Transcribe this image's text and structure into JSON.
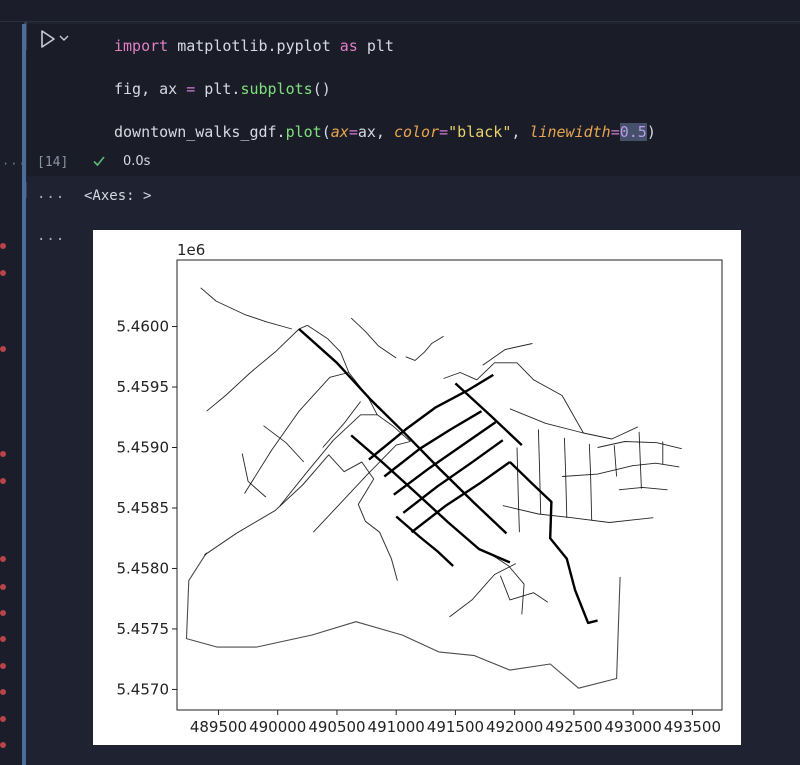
{
  "cell": {
    "execution_count": "[14]",
    "exec_time": "0.0s",
    "code": {
      "line1": {
        "kw1": "import",
        "mod": " matplotlib.pyplot ",
        "kw2": "as",
        "alias": " plt"
      },
      "line2": {
        "vars": "fig, ax ",
        "eq": "=",
        "sp": " plt.",
        "fn": "subplots",
        "paren": "()"
      },
      "line3": {
        "obj": "downtown_walks_gdf.",
        "fn": "plot",
        "p_open": "(",
        "arg1": "ax",
        "eq1": "=",
        "v1": "ax, ",
        "arg2": "color",
        "eq2": "=",
        "v2": "\"black\"",
        "comma": ", ",
        "arg3": "linewidth",
        "eq3": "=",
        "v3": "0.5",
        "p_close": ")"
      }
    }
  },
  "output": {
    "ellipsis_1": "···",
    "ellipsis_2": "···",
    "text": "<Axes: >"
  },
  "gutter": {
    "dotted": "·····"
  },
  "icons": {
    "run": "play-icon",
    "run_options": "chevron-down-icon",
    "success": "check-icon"
  },
  "colors": {
    "cell_bar": "#4b6d9a",
    "success": "#5fb877",
    "error_dot": "#b8434b"
  },
  "chart_data": {
    "type": "line",
    "title": "",
    "offset_label": "1e6",
    "xlabel": "",
    "ylabel": "",
    "xlim": [
      489150,
      493750
    ],
    "ylim": [
      5456830,
      5460550
    ],
    "x_ticks": [
      489500,
      490000,
      490500,
      491000,
      491500,
      492000,
      492500,
      493000,
      493500
    ],
    "x_tick_labels": [
      "489500",
      "490000",
      "490500",
      "491000",
      "491500",
      "492000",
      "492500",
      "493000",
      "493500"
    ],
    "y_ticks": [
      5457000,
      5457500,
      5458000,
      5458500,
      5459000,
      5459500,
      5460000
    ],
    "y_tick_labels": [
      "5.4570",
      "5.4575",
      "5.4580",
      "5.4585",
      "5.4590",
      "5.4595",
      "5.4600"
    ],
    "color": "#000000",
    "linewidth": 0.5,
    "series": [
      {
        "type": "boundary",
        "points": [
          [
            489400,
            5458130
          ],
          [
            489250,
            5457900
          ],
          [
            489230,
            5457420
          ],
          [
            489490,
            5457350
          ],
          [
            489820,
            5457350
          ],
          [
            490290,
            5457450
          ],
          [
            490660,
            5457560
          ],
          [
            491050,
            5457450
          ],
          [
            491360,
            5457310
          ],
          [
            491660,
            5457280
          ],
          [
            491960,
            5457160
          ],
          [
            492300,
            5457210
          ],
          [
            492540,
            5457010
          ],
          [
            492860,
            5457090
          ],
          [
            492890,
            5457930
          ]
        ]
      },
      {
        "type": "shore",
        "points": [
          [
            489380,
            5458110
          ],
          [
            489650,
            5458290
          ],
          [
            489980,
            5458480
          ],
          [
            490210,
            5458690
          ],
          [
            490430,
            5458940
          ],
          [
            490560,
            5458800
          ],
          [
            490710,
            5458880
          ],
          [
            490810,
            5458740
          ],
          [
            490680,
            5458530
          ],
          [
            490740,
            5458390
          ],
          [
            490860,
            5458300
          ],
          [
            490960,
            5458080
          ],
          [
            491010,
            5457900
          ]
        ]
      },
      {
        "type": "grid",
        "points": [
          [
            489400,
            5459300
          ],
          [
            489560,
            5459430
          ],
          [
            489770,
            5459620
          ],
          [
            489980,
            5459790
          ],
          [
            490180,
            5459980
          ],
          [
            490250,
            5460010
          ]
        ]
      },
      {
        "type": "grid",
        "points": [
          [
            489350,
            5460320
          ],
          [
            489480,
            5460210
          ],
          [
            489720,
            5460100
          ],
          [
            489900,
            5460040
          ],
          [
            490120,
            5459980
          ]
        ]
      },
      {
        "type": "grid",
        "points": [
          [
            490250,
            5460010
          ],
          [
            490420,
            5459900
          ],
          [
            490530,
            5459790
          ],
          [
            490600,
            5459620
          ],
          [
            490760,
            5459420
          ],
          [
            490840,
            5459270
          ],
          [
            490970,
            5459180
          ],
          [
            491120,
            5459050
          ]
        ]
      },
      {
        "type": "grid",
        "points": [
          [
            489720,
            5458620
          ],
          [
            489950,
            5458980
          ],
          [
            490180,
            5459300
          ],
          [
            490440,
            5459580
          ],
          [
            490600,
            5459620
          ]
        ]
      },
      {
        "type": "grid",
        "points": [
          [
            490020,
            5458520
          ],
          [
            490250,
            5458800
          ],
          [
            490470,
            5459060
          ],
          [
            490700,
            5459270
          ],
          [
            490840,
            5459270
          ]
        ]
      },
      {
        "type": "grid",
        "points": [
          [
            490300,
            5458300
          ],
          [
            490540,
            5458550
          ],
          [
            490750,
            5458770
          ],
          [
            491000,
            5459020
          ],
          [
            491120,
            5459050
          ]
        ]
      },
      {
        "type": "major",
        "points": [
          [
            490180,
            5459980
          ],
          [
            490500,
            5459700
          ],
          [
            490780,
            5459400
          ],
          [
            491080,
            5459110
          ],
          [
            491360,
            5458830
          ],
          [
            491660,
            5458540
          ],
          [
            491930,
            5458290
          ]
        ]
      },
      {
        "type": "major",
        "points": [
          [
            490620,
            5459100
          ],
          [
            490880,
            5458880
          ],
          [
            491150,
            5458640
          ],
          [
            491440,
            5458380
          ],
          [
            491700,
            5458160
          ],
          [
            491960,
            5458050
          ]
        ]
      },
      {
        "type": "major",
        "points": [
          [
            490770,
            5458900
          ],
          [
            491080,
            5459150
          ],
          [
            491330,
            5459330
          ],
          [
            491600,
            5459470
          ],
          [
            491820,
            5459600
          ]
        ]
      },
      {
        "type": "major",
        "points": [
          [
            490900,
            5458760
          ],
          [
            491200,
            5458990
          ],
          [
            491460,
            5459150
          ],
          [
            491720,
            5459300
          ]
        ]
      },
      {
        "type": "major",
        "points": [
          [
            490980,
            5458610
          ],
          [
            491280,
            5458830
          ],
          [
            491560,
            5459020
          ],
          [
            491840,
            5459210
          ]
        ]
      },
      {
        "type": "major",
        "points": [
          [
            491060,
            5458460
          ],
          [
            491350,
            5458680
          ],
          [
            491630,
            5458870
          ],
          [
            491900,
            5459060
          ]
        ]
      },
      {
        "type": "major",
        "points": [
          [
            491130,
            5458300
          ],
          [
            491420,
            5458520
          ],
          [
            491700,
            5458700
          ],
          [
            491960,
            5458880
          ]
        ]
      },
      {
        "type": "major",
        "points": [
          [
            491000,
            5458430
          ],
          [
            491200,
            5458260
          ],
          [
            491350,
            5458140
          ],
          [
            491480,
            5458020
          ]
        ]
      },
      {
        "type": "major",
        "points": [
          [
            491500,
            5459530
          ],
          [
            491800,
            5459260
          ],
          [
            492060,
            5459020
          ]
        ]
      },
      {
        "type": "grid",
        "points": [
          [
            491400,
            5459570
          ],
          [
            491540,
            5459620
          ],
          [
            491680,
            5459560
          ],
          [
            491830,
            5459700
          ],
          [
            492020,
            5459700
          ],
          [
            492160,
            5459560
          ],
          [
            492400,
            5459430
          ],
          [
            492580,
            5459120
          ]
        ]
      },
      {
        "type": "grid",
        "points": [
          [
            491730,
            5459680
          ],
          [
            491920,
            5459810
          ],
          [
            492150,
            5459860
          ]
        ]
      },
      {
        "type": "grid",
        "points": [
          [
            491960,
            5459320
          ],
          [
            492260,
            5459200
          ],
          [
            492580,
            5459120
          ],
          [
            492820,
            5459070
          ],
          [
            493040,
            5459170
          ]
        ]
      },
      {
        "type": "grid",
        "points": [
          [
            491900,
            5458520
          ],
          [
            492200,
            5458450
          ],
          [
            492480,
            5458420
          ],
          [
            492800,
            5458380
          ],
          [
            493170,
            5458420
          ]
        ]
      },
      {
        "type": "grid",
        "points": [
          [
            492400,
            5458760
          ],
          [
            492700,
            5458780
          ],
          [
            493000,
            5458850
          ],
          [
            493190,
            5458870
          ],
          [
            493390,
            5458840
          ]
        ]
      },
      {
        "type": "grid",
        "points": [
          [
            492700,
            5459000
          ],
          [
            492930,
            5459050
          ],
          [
            493200,
            5459040
          ],
          [
            493410,
            5458990
          ]
        ]
      },
      {
        "type": "grid",
        "points": [
          [
            492880,
            5458650
          ],
          [
            493080,
            5458670
          ],
          [
            493290,
            5458650
          ]
        ]
      },
      {
        "type": "grid",
        "points": [
          [
            492020,
            5459000
          ],
          [
            492030,
            5458620
          ],
          [
            492040,
            5458300
          ]
        ]
      },
      {
        "type": "grid",
        "points": [
          [
            492200,
            5459150
          ],
          [
            492210,
            5458840
          ],
          [
            492220,
            5458450
          ]
        ]
      },
      {
        "type": "grid",
        "points": [
          [
            492420,
            5459080
          ],
          [
            492430,
            5458800
          ],
          [
            492440,
            5458420
          ]
        ]
      },
      {
        "type": "grid",
        "points": [
          [
            492630,
            5459030
          ],
          [
            492640,
            5458800
          ],
          [
            492650,
            5458400
          ]
        ]
      },
      {
        "type": "grid",
        "points": [
          [
            492840,
            5459020
          ],
          [
            492860,
            5458760
          ]
        ]
      },
      {
        "type": "grid",
        "points": [
          [
            493050,
            5459130
          ],
          [
            493060,
            5458880
          ],
          [
            493070,
            5458660
          ]
        ]
      },
      {
        "type": "grid",
        "points": [
          [
            493250,
            5459050
          ],
          [
            493250,
            5458860
          ]
        ]
      },
      {
        "type": "major",
        "points": [
          [
            491960,
            5458880
          ],
          [
            492150,
            5458700
          ],
          [
            492310,
            5458550
          ],
          [
            492300,
            5458250
          ],
          [
            492440,
            5458080
          ],
          [
            492510,
            5457820
          ],
          [
            492620,
            5457550
          ],
          [
            492700,
            5457570
          ]
        ]
      },
      {
        "type": "grid",
        "points": [
          [
            491780,
            5458130
          ],
          [
            491950,
            5458020
          ],
          [
            492080,
            5457870
          ],
          [
            492060,
            5457620
          ]
        ]
      },
      {
        "type": "grid",
        "points": [
          [
            491450,
            5457600
          ],
          [
            491640,
            5457740
          ],
          [
            491830,
            5457950
          ],
          [
            492010,
            5458040
          ]
        ]
      },
      {
        "type": "grid",
        "points": [
          [
            491880,
            5457940
          ],
          [
            491960,
            5457740
          ],
          [
            492160,
            5457800
          ],
          [
            492280,
            5457720
          ]
        ]
      },
      {
        "type": "grid",
        "points": [
          [
            490620,
            5460070
          ],
          [
            490740,
            5459960
          ],
          [
            490850,
            5459840
          ],
          [
            491000,
            5459740
          ]
        ]
      },
      {
        "type": "grid",
        "points": [
          [
            491080,
            5459750
          ],
          [
            491160,
            5459720
          ],
          [
            491240,
            5459790
          ],
          [
            491300,
            5459860
          ],
          [
            491400,
            5459920
          ]
        ]
      },
      {
        "type": "grid",
        "points": [
          [
            490380,
            5459000
          ],
          [
            490560,
            5459200
          ],
          [
            490700,
            5459380
          ]
        ]
      },
      {
        "type": "grid",
        "points": [
          [
            489880,
            5459180
          ],
          [
            490070,
            5459040
          ],
          [
            490220,
            5458880
          ]
        ]
      },
      {
        "type": "grid",
        "points": [
          [
            489700,
            5458950
          ],
          [
            489750,
            5458720
          ],
          [
            489900,
            5458590
          ]
        ]
      }
    ]
  }
}
